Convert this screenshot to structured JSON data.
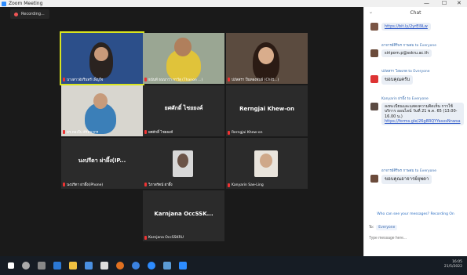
{
  "window": {
    "title": "Zoom Meeting",
    "minimize": "—",
    "maximize": "☐",
    "close": "✕"
  },
  "recording": {
    "label": "Recording..."
  },
  "tiles": [
    {
      "name": "นางสาวอัยรินทร์ เพ็ญใจ"
    },
    {
      "name": "ธนันท์ ธนนาวา กาวีสุ (Thanon ...)"
    },
    {
      "name": "ปภัสสรา ปิ่นทองพันธ์ (Chitt...)"
    },
    {
      "name": "ดร.ทองใบ ตีรัตนากร"
    },
    {
      "big": "ยศศักดิ์ ไชยยงค์",
      "name": "ยศศักดิ์ ไชยยงค์"
    },
    {
      "big": "Rerngjai Khew-on",
      "name": "Rerngjai Khew-on"
    },
    {
      "big": "นงปรีดา ผ่าผึ้ง(IP...",
      "name": "นงปรีดา ผ่าผึ้ง(iPhone)"
    },
    {
      "name": "วิภาสรัตน์ ผ่าผึ้ง"
    },
    {
      "name": "Kanyarin Sae-Ling"
    },
    {
      "big": "Karnjana OccSSK...",
      "name": "Karnjana OccSSKRU"
    }
  ],
  "chat": {
    "title": "Chat",
    "messages": [
      {
        "text": "https://bit.ly/2yrEl9Lw",
        "link": true
      },
      {
        "from": "อาจารย์ศิริพร กาษสม to Everyone",
        "text": "siriporn.p@sskru.ac.th"
      },
      {
        "from": "ปภัสสรา โอษเกต to Everyone",
        "text": "ขอบคุณครับ"
      },
      {
        "from": "Kanyarin ผ่าผึ้ง to Everyone",
        "text": "ลงทะเบียนและแสดงความคิดเห็น การใช้บริการ ออนไลน์ วันที่ 21 พ.ค. 65 (13.00-16.00 น.)",
        "link_text": "https://forms.gle/26g8RQYYasxsNnwsa"
      },
      {
        "from": "อาจารย์ศิริพร กาษสม to Everyone",
        "text": "ขอบคุณอาจารย์ยุพดา"
      }
    ],
    "visibility": "Who can see your messages? Recording On",
    "to_label": "To:",
    "to_value": "Everyone",
    "input_placeholder": "Type message here..."
  },
  "taskbar": {
    "time": "16:05",
    "date": "21/5/2022"
  }
}
